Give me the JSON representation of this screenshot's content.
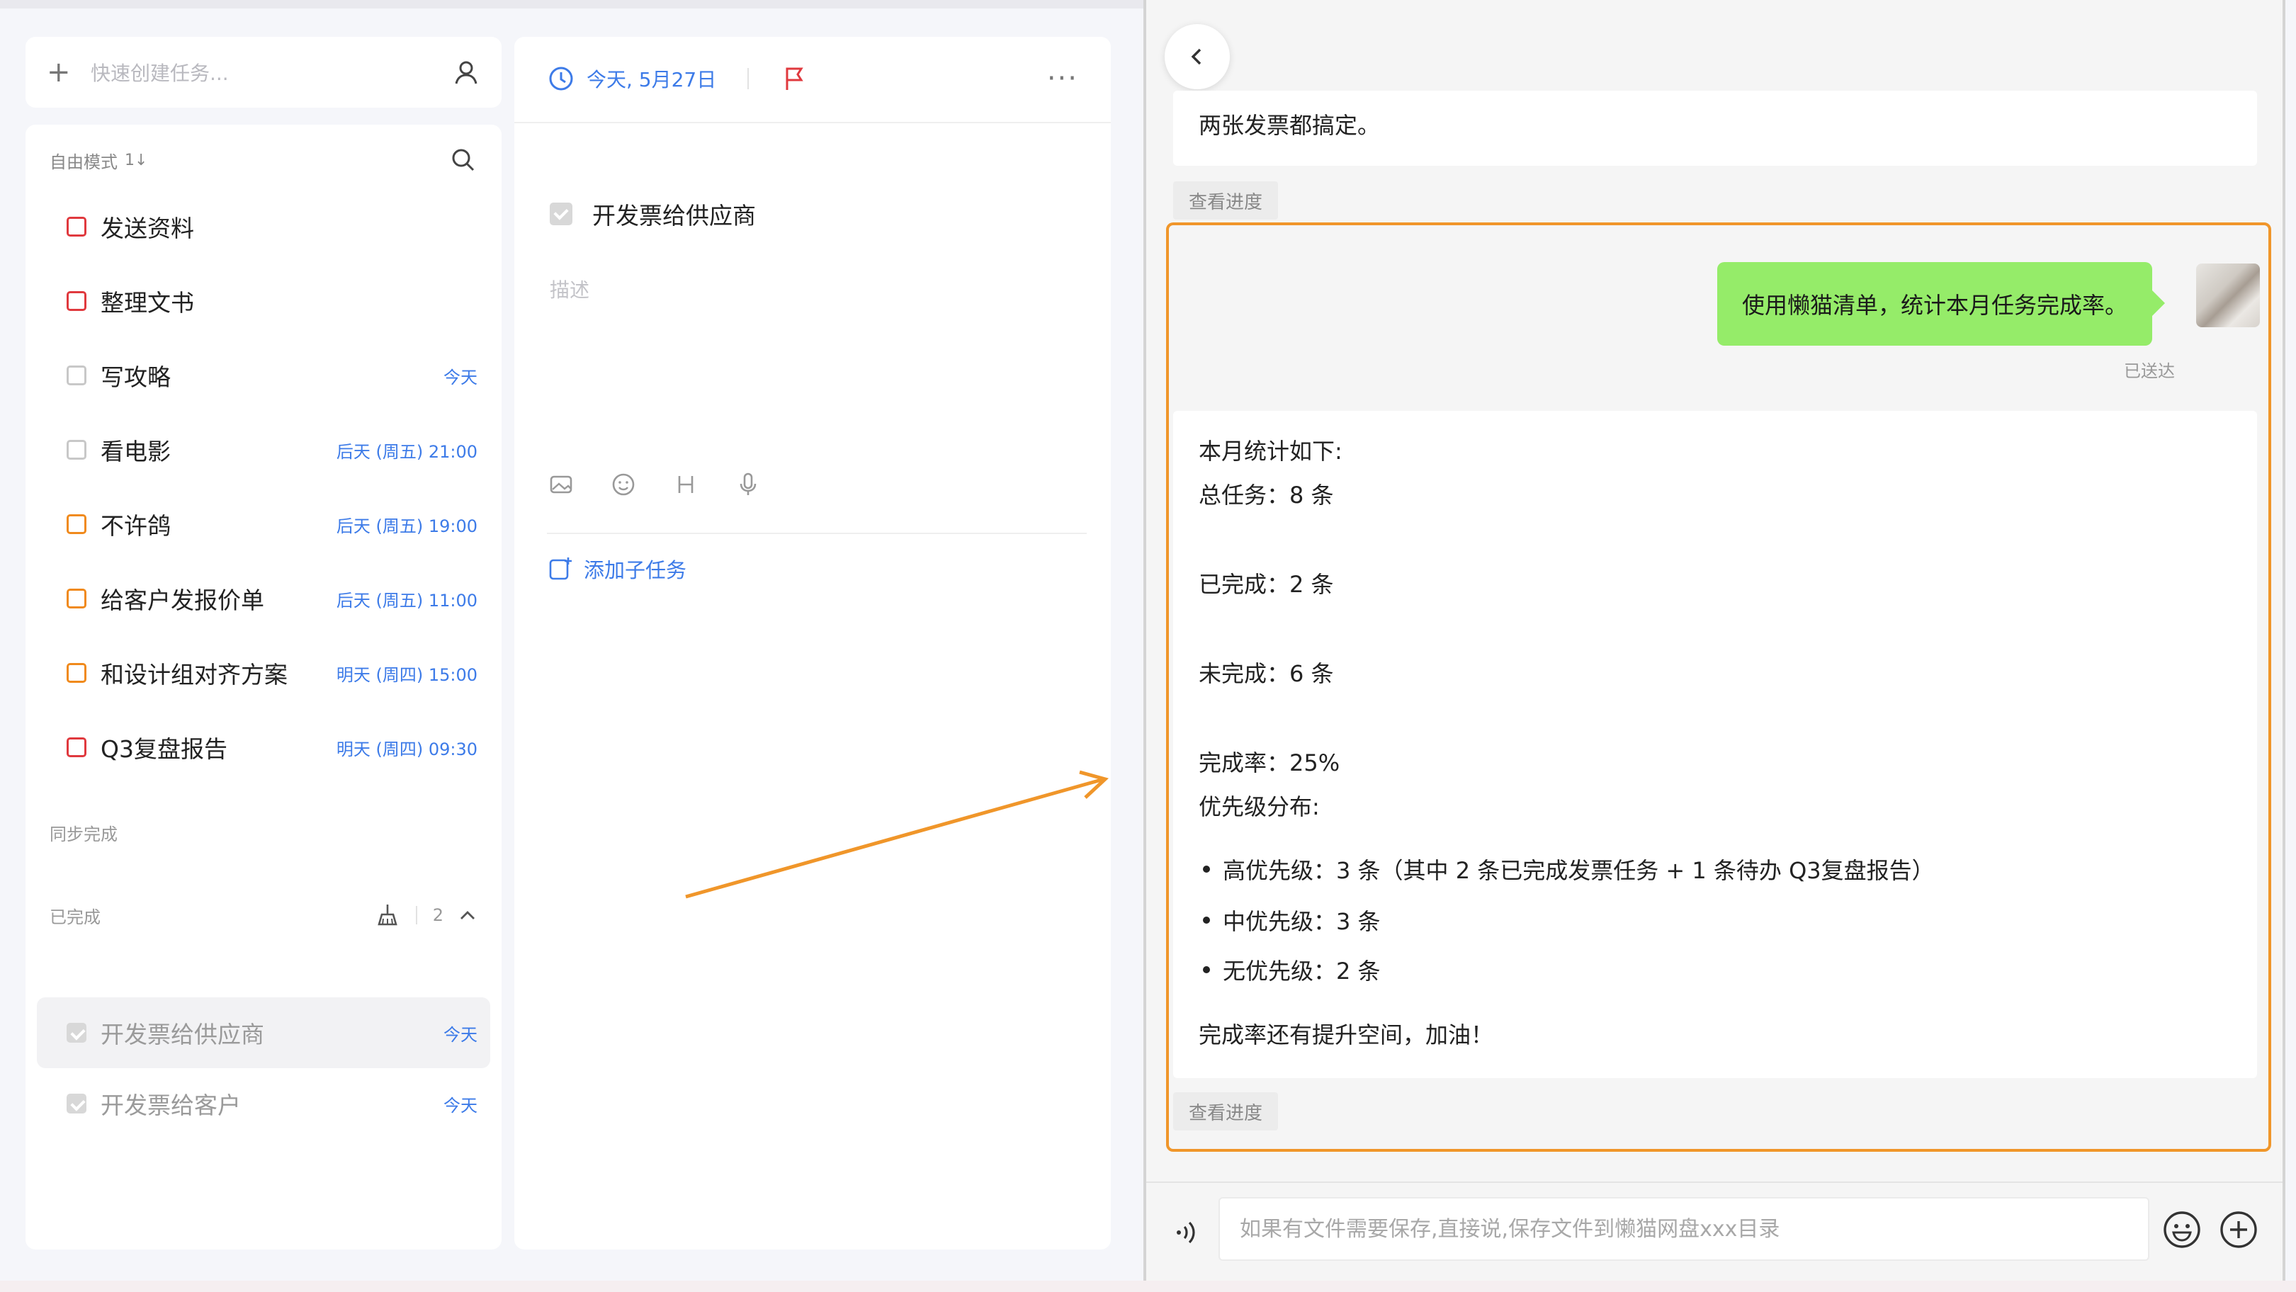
{
  "left": {
    "quick_add_placeholder": "快速创建任务...",
    "mode_label": "自由模式",
    "sort_label": "1↓",
    "tasks": [
      {
        "title": "发送资料",
        "due": "",
        "color": "#e0393e"
      },
      {
        "title": "整理文书",
        "due": "",
        "color": "#e0393e"
      },
      {
        "title": "写攻略",
        "due": "今天",
        "color": "#c8c8c8"
      },
      {
        "title": "看电影",
        "due": "后天 (周五) 21:00",
        "color": "#c8c8c8"
      },
      {
        "title": "不许鸽",
        "due": "后天 (周五) 19:00",
        "color": "#f08a1c"
      },
      {
        "title": "给客户发报价单",
        "due": "后天 (周五) 11:00",
        "color": "#f08a1c"
      },
      {
        "title": "和设计组对齐方案",
        "due": "明天 (周四) 15:00",
        "color": "#f08a1c"
      },
      {
        "title": "Q3复盘报告",
        "due": "明天 (周四) 09:30",
        "color": "#e0393e"
      }
    ],
    "sync_label": "同步完成",
    "completed_label": "已完成",
    "completed_count": "2",
    "completed_tasks": [
      {
        "title": "开发票给供应商",
        "due": "今天"
      },
      {
        "title": "开发票给客户",
        "due": "今天"
      }
    ]
  },
  "middle": {
    "date": "今天, 5月27日",
    "more": "···",
    "task_title": "开发票给供应商",
    "desc_placeholder": "描述",
    "add_subtask": "添加子任务"
  },
  "chat": {
    "prev_message": "两张发票都搞定。",
    "view_progress": "查看进度",
    "user_message": "使用懒猫清单，统计本月任务完成率。",
    "status": "已送达",
    "reply": {
      "l1": "本月统计如下:",
      "l2": "总任务：8 条",
      "l3": "已完成：2 条",
      "l4": "未完成：6 条",
      "l5": "完成率：25%",
      "l6": "优先级分布:",
      "b1": "高优先级：3 条（其中 2 条已完成发票任务 + 1 条待办 Q3复盘报告）",
      "b2": "中优先级：3 条",
      "b3": "无优先级：2 条",
      "l7": "完成率还有提升空间，加油！"
    },
    "input_placeholder": "如果有文件需要保存,直接说,保存文件到懒猫网盘xxx目录"
  },
  "colors": {
    "accent": "#3d7be8",
    "highlight": "#f0962a",
    "bubble": "#95ec69",
    "flag": "#e0393e"
  }
}
